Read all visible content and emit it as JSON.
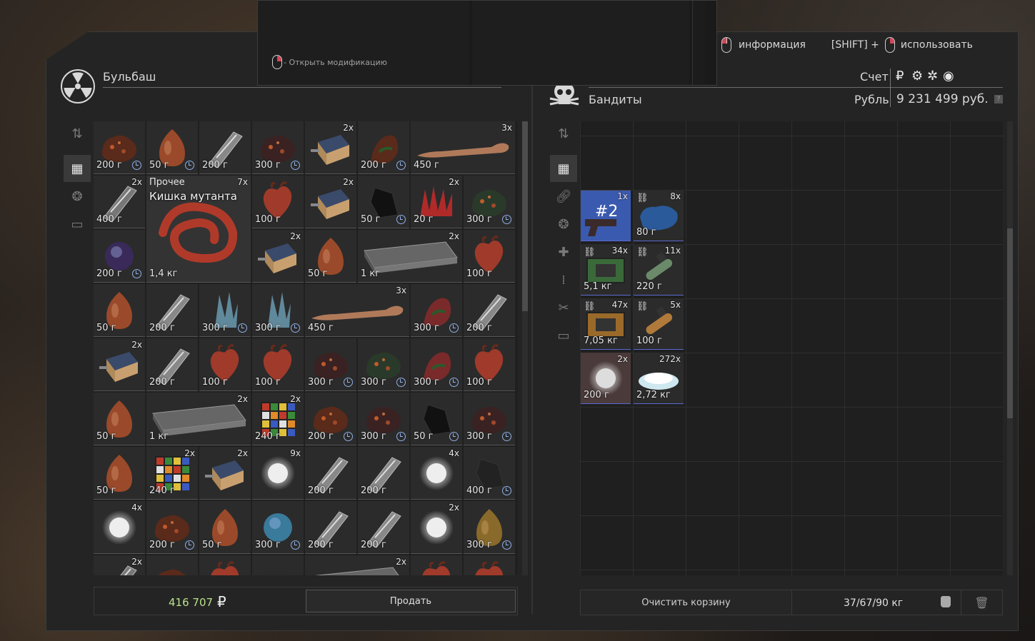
{
  "mod_popup": {
    "hint": "- Открыть модификацию"
  },
  "top_hints": {
    "info_label": "информация",
    "shift_label": "[SHIFT] +",
    "use_label": "использовать"
  },
  "player": {
    "name": "Бульбаш",
    "money": "416 707",
    "currency_sign": "₽",
    "sell_label": "Продать"
  },
  "npc": {
    "name": "Бандиты",
    "account_label": "Счет",
    "currency_label": "Рубль",
    "balance": "9 231 499 руб.",
    "help": "?",
    "clear_label": "Очистить корзину",
    "weight": "37/67/90 кг"
  },
  "left_items": [
    {
      "price": "200 г",
      "clock": true,
      "qty": "",
      "art": "dark-rock",
      "color": "#5a2a1a",
      "span": 1
    },
    {
      "price": "50 г",
      "clock": true,
      "qty": "",
      "art": "onion",
      "color": "#9a4a2a",
      "span": 1
    },
    {
      "price": "200 г",
      "clock": false,
      "qty": "",
      "art": "metal",
      "color": "#888",
      "span": 1
    },
    {
      "price": "300 г",
      "clock": true,
      "qty": "",
      "art": "dark-rock",
      "color": "#3a2222",
      "span": 1
    },
    {
      "price": "",
      "clock": false,
      "qty": "2x",
      "art": "box",
      "color": "#b08a5a",
      "span": 1
    },
    {
      "price": "200 г",
      "clock": true,
      "qty": "",
      "art": "claw",
      "color": "#5a2a1a",
      "span": 1
    },
    {
      "price": "450 г",
      "clock": false,
      "qty": "3x",
      "art": "bone",
      "color": "#b07a5a",
      "span": 2
    },
    {
      "price": "400 г",
      "clock": false,
      "qty": "2x",
      "art": "metal",
      "color": "#777",
      "span": 1
    },
    {
      "price": "100 г",
      "clock": false,
      "qty": "",
      "art": "heart",
      "color": "#a03a2a",
      "span": 1
    },
    {
      "price": "",
      "clock": false,
      "qty": "2x",
      "art": "box",
      "color": "#b08a5a",
      "span": 1
    },
    {
      "price": "50 г",
      "clock": true,
      "qty": "",
      "art": "shard",
      "color": "#111",
      "span": 1
    },
    {
      "price": "20 г",
      "clock": false,
      "qty": "2x",
      "art": "spikes",
      "color": "#b02a2a",
      "span": 1
    },
    {
      "price": "300 г",
      "clock": true,
      "qty": "",
      "art": "dark-rock",
      "color": "#2a3a2a",
      "span": 1
    },
    {
      "price": "200 г",
      "clock": true,
      "qty": "",
      "art": "orb",
      "color": "#3a2a5a",
      "span": 1
    },
    {
      "price": "",
      "clock": false,
      "qty": "2x",
      "art": "box",
      "color": "#b08a5a",
      "span": 1
    },
    {
      "price": "50 г",
      "clock": false,
      "qty": "",
      "art": "onion",
      "color": "#9a4a2a",
      "span": 1
    },
    {
      "price": "1 кг",
      "clock": false,
      "qty": "2x",
      "art": "case",
      "color": "#666",
      "span": 2
    },
    {
      "price": "100 г",
      "clock": false,
      "qty": "",
      "art": "heart",
      "color": "#a03a2a",
      "span": 1
    },
    {
      "price": "50 г",
      "clock": false,
      "qty": "",
      "art": "onion",
      "color": "#9a4a2a",
      "span": 1
    },
    {
      "price": "200 г",
      "clock": false,
      "qty": "",
      "art": "metal",
      "color": "#888",
      "span": 1
    },
    {
      "price": "300 г",
      "clock": true,
      "qty": "",
      "art": "crystal",
      "color": "#6a9ab0",
      "span": 1
    },
    {
      "price": "300 г",
      "clock": true,
      "qty": "",
      "art": "crystal",
      "color": "#6a9ab0",
      "span": 1
    },
    {
      "price": "450 г",
      "clock": false,
      "qty": "3x",
      "art": "bone",
      "color": "#b07a5a",
      "span": 2
    },
    {
      "price": "300 г",
      "clock": true,
      "qty": "",
      "art": "claw",
      "color": "#7a2a2a",
      "span": 1
    },
    {
      "price": "200 г",
      "clock": false,
      "qty": "",
      "art": "metal",
      "color": "#888",
      "span": 1
    },
    {
      "price": "",
      "clock": false,
      "qty": "2x",
      "art": "box",
      "color": "#b08a5a",
      "span": 1
    },
    {
      "price": "200 г",
      "clock": false,
      "qty": "",
      "art": "metal",
      "color": "#888",
      "span": 1
    },
    {
      "price": "100 г",
      "clock": false,
      "qty": "",
      "art": "heart",
      "color": "#a03a2a",
      "span": 1
    },
    {
      "price": "100 г",
      "clock": false,
      "qty": "",
      "art": "heart",
      "color": "#a03a2a",
      "span": 1
    },
    {
      "price": "300 г",
      "clock": true,
      "qty": "",
      "art": "dark-rock",
      "color": "#3a2222",
      "span": 1
    },
    {
      "price": "300 г",
      "clock": true,
      "qty": "",
      "art": "dark-rock",
      "color": "#2a3a2a",
      "span": 1
    },
    {
      "price": "300 г",
      "clock": true,
      "qty": "",
      "art": "claw",
      "color": "#7a2a2a",
      "span": 1
    },
    {
      "price": "100 г",
      "clock": false,
      "qty": "",
      "art": "heart",
      "color": "#a03a2a",
      "span": 1
    },
    {
      "price": "50 г",
      "clock": false,
      "qty": "",
      "art": "onion",
      "color": "#9a4a2a",
      "span": 1
    },
    {
      "price": "1 кг",
      "clock": false,
      "qty": "2x",
      "art": "case",
      "color": "#666",
      "span": 2
    },
    {
      "price": "240 г",
      "clock": false,
      "qty": "2x",
      "art": "cube",
      "color": "#c04a3a",
      "span": 1
    },
    {
      "price": "200 г",
      "clock": true,
      "qty": "",
      "art": "dark-rock",
      "color": "#5a2a1a",
      "span": 1
    },
    {
      "price": "300 г",
      "clock": true,
      "qty": "",
      "art": "dark-rock",
      "color": "#3a2222",
      "span": 1
    },
    {
      "price": "50 г",
      "clock": true,
      "qty": "",
      "art": "shard",
      "color": "#111",
      "span": 1
    },
    {
      "price": "300 г",
      "clock": true,
      "qty": "",
      "art": "dark-rock",
      "color": "#3a2222",
      "span": 1
    },
    {
      "price": "50 г",
      "clock": false,
      "qty": "",
      "art": "onion",
      "color": "#9a4a2a",
      "span": 1
    },
    {
      "price": "240 г",
      "clock": false,
      "qty": "2x",
      "art": "cube",
      "color": "#c04a3a",
      "span": 1
    },
    {
      "price": "",
      "clock": false,
      "qty": "2x",
      "art": "box",
      "color": "#b08a5a",
      "span": 1
    },
    {
      "price": "",
      "clock": false,
      "qty": "9x",
      "art": "white",
      "color": "#eee",
      "span": 1
    },
    {
      "price": "200 г",
      "clock": false,
      "qty": "",
      "art": "metal",
      "color": "#888",
      "span": 1
    },
    {
      "price": "200 г",
      "clock": false,
      "qty": "",
      "art": "metal",
      "color": "#888",
      "span": 1
    },
    {
      "price": "",
      "clock": false,
      "qty": "4x",
      "art": "white",
      "color": "#eee",
      "span": 1
    },
    {
      "price": "400 г",
      "clock": true,
      "qty": "",
      "art": "shard",
      "color": "#222",
      "span": 1
    },
    {
      "price": "",
      "clock": false,
      "qty": "4x",
      "art": "white",
      "color": "#eee",
      "span": 1
    },
    {
      "price": "200 г",
      "clock": true,
      "qty": "",
      "art": "dark-rock",
      "color": "#5a2a1a",
      "span": 1
    },
    {
      "price": "50 г",
      "clock": false,
      "qty": "",
      "art": "onion",
      "color": "#9a4a2a",
      "span": 1
    },
    {
      "price": "300 г",
      "clock": true,
      "qty": "",
      "art": "orb",
      "color": "#3a7a9a",
      "span": 1
    },
    {
      "price": "200 г",
      "clock": false,
      "qty": "",
      "art": "metal",
      "color": "#888",
      "span": 1
    },
    {
      "price": "200 г",
      "clock": false,
      "qty": "",
      "art": "metal",
      "color": "#888",
      "span": 1
    },
    {
      "price": "",
      "clock": false,
      "qty": "2x",
      "art": "white",
      "color": "#eee",
      "span": 1
    },
    {
      "price": "300 г",
      "clock": true,
      "qty": "",
      "art": "onion",
      "color": "#8a6a2a",
      "span": 1
    },
    {
      "price": "",
      "clock": false,
      "qty": "2x",
      "art": "metal",
      "color": "#777",
      "span": 1
    },
    {
      "price": "",
      "clock": false,
      "qty": "",
      "art": "dark-rock",
      "color": "#5a2a1a",
      "span": 1
    },
    {
      "price": "",
      "clock": false,
      "qty": "",
      "art": "heart",
      "color": "#a03a2a",
      "span": 1
    },
    {
      "price": "",
      "clock": false,
      "qty": "",
      "art": "dark-rock",
      "color": "#2a2a2a",
      "span": 1
    },
    {
      "price": "",
      "clock": false,
      "qty": "2x",
      "art": "case",
      "color": "#666",
      "span": 2
    },
    {
      "price": "",
      "clock": false,
      "qty": "",
      "art": "heart",
      "color": "#a03a2a",
      "span": 1
    },
    {
      "price": "",
      "clock": false,
      "qty": "",
      "art": "heart",
      "color": "#a03a2a",
      "span": 1
    },
    {
      "price": "",
      "clock": false,
      "qty": "",
      "art": "dark-rock",
      "color": "#3a2222",
      "span": 1
    }
  ],
  "big_item": {
    "category": "Прочее",
    "name": "Кишка мутанта",
    "qty": "7x",
    "weight": "1,4 кг",
    "color": "#b03a2a"
  },
  "right_items": [
    {
      "label": "#2",
      "qty": "1x",
      "price": "",
      "art": "pistol",
      "color": "#3a5ab0",
      "link": false,
      "selected": true
    },
    {
      "label": "",
      "qty": "8x",
      "price": "80 г",
      "art": "blue-blob",
      "color": "#2a5a9a",
      "link": true,
      "selected": false
    },
    {
      "label": "",
      "qty": "34x",
      "price": "5,1 кг",
      "art": "green-pack",
      "color": "#3a6a3a",
      "link": true,
      "selected": false
    },
    {
      "label": "",
      "qty": "11x",
      "price": "220 г",
      "art": "tube",
      "color": "#6a8a6a",
      "link": true,
      "selected": false
    },
    {
      "label": "",
      "qty": "47x",
      "price": "7,05 кг",
      "art": "orange-pack",
      "color": "#9a6a2a",
      "link": true,
      "selected": false
    },
    {
      "label": "",
      "qty": "5x",
      "price": "100 г",
      "art": "tube",
      "color": "#b07a3a",
      "link": true,
      "selected": false
    },
    {
      "label": "",
      "qty": "2x",
      "price": "200 г",
      "art": "white",
      "color": "#ddd",
      "link": false,
      "selected": true
    },
    {
      "label": "",
      "qty": "272x",
      "price": "2,72 кг",
      "art": "salt",
      "color": "#cfe8f0",
      "link": false,
      "selected": false
    }
  ],
  "left_tabs": [
    "sort",
    "grid",
    "artifacts",
    "archive"
  ],
  "right_tabs": [
    "sort",
    "grid",
    "attachments",
    "artifacts",
    "medkit",
    "ammo",
    "tools",
    "archive"
  ]
}
